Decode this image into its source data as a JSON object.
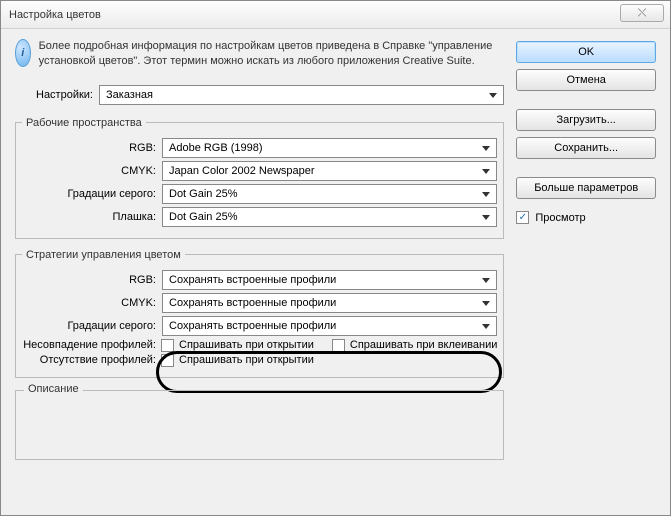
{
  "window": {
    "title": "Настройка цветов",
    "close_glyph": "⤬"
  },
  "info": {
    "icon_glyph": "i",
    "text": "Более подробная информация по настройкам цветов приведена в Справке \"управление установкой цветов\". Этот термин можно искать из любого приложения Creative Suite."
  },
  "settings": {
    "label": "Настройки:",
    "value": "Заказная"
  },
  "workspaces": {
    "legend": "Рабочие пространства",
    "rgb_label": "RGB:",
    "rgb_value": "Adobe RGB (1998)",
    "cmyk_label": "CMYK:",
    "cmyk_value": "Japan Color 2002 Newspaper",
    "gray_label": "Градации серого:",
    "gray_value": "Dot Gain 25%",
    "spot_label": "Плашка:",
    "spot_value": "Dot Gain 25%"
  },
  "policies": {
    "legend": "Стратегии управления цветом",
    "rgb_label": "RGB:",
    "rgb_value": "Сохранять встроенные профили",
    "cmyk_label": "CMYK:",
    "cmyk_value": "Сохранять встроенные профили",
    "gray_label": "Градации серого:",
    "gray_value": "Сохранять встроенные профили",
    "mismatch_label": "Несовпадение профилей:",
    "mismatch_open": "Спрашивать при открытии",
    "mismatch_paste": "Спрашивать при вклеивании",
    "missing_label": "Отсутствие профилей:",
    "missing_open": "Спрашивать при открытии"
  },
  "description": {
    "legend": "Описание"
  },
  "buttons": {
    "ok": "OK",
    "cancel": "Отмена",
    "load": "Загрузить...",
    "save": "Сохранить...",
    "more": "Больше параметров"
  },
  "preview": {
    "label": "Просмотр"
  }
}
